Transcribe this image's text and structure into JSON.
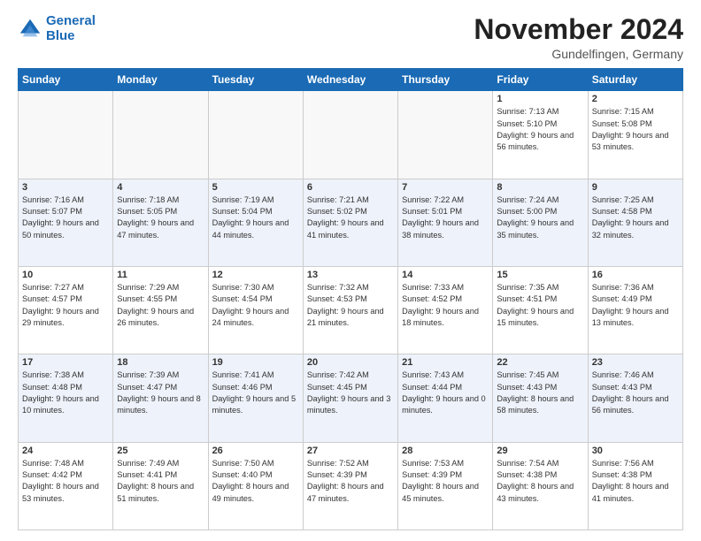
{
  "header": {
    "logo_line1": "General",
    "logo_line2": "Blue",
    "month_title": "November 2024",
    "location": "Gundelfingen, Germany"
  },
  "weekdays": [
    "Sunday",
    "Monday",
    "Tuesday",
    "Wednesday",
    "Thursday",
    "Friday",
    "Saturday"
  ],
  "weeks": [
    [
      {
        "day": "",
        "info": ""
      },
      {
        "day": "",
        "info": ""
      },
      {
        "day": "",
        "info": ""
      },
      {
        "day": "",
        "info": ""
      },
      {
        "day": "",
        "info": ""
      },
      {
        "day": "1",
        "info": "Sunrise: 7:13 AM\nSunset: 5:10 PM\nDaylight: 9 hours and 56 minutes."
      },
      {
        "day": "2",
        "info": "Sunrise: 7:15 AM\nSunset: 5:08 PM\nDaylight: 9 hours and 53 minutes."
      }
    ],
    [
      {
        "day": "3",
        "info": "Sunrise: 7:16 AM\nSunset: 5:07 PM\nDaylight: 9 hours and 50 minutes."
      },
      {
        "day": "4",
        "info": "Sunrise: 7:18 AM\nSunset: 5:05 PM\nDaylight: 9 hours and 47 minutes."
      },
      {
        "day": "5",
        "info": "Sunrise: 7:19 AM\nSunset: 5:04 PM\nDaylight: 9 hours and 44 minutes."
      },
      {
        "day": "6",
        "info": "Sunrise: 7:21 AM\nSunset: 5:02 PM\nDaylight: 9 hours and 41 minutes."
      },
      {
        "day": "7",
        "info": "Sunrise: 7:22 AM\nSunset: 5:01 PM\nDaylight: 9 hours and 38 minutes."
      },
      {
        "day": "8",
        "info": "Sunrise: 7:24 AM\nSunset: 5:00 PM\nDaylight: 9 hours and 35 minutes."
      },
      {
        "day": "9",
        "info": "Sunrise: 7:25 AM\nSunset: 4:58 PM\nDaylight: 9 hours and 32 minutes."
      }
    ],
    [
      {
        "day": "10",
        "info": "Sunrise: 7:27 AM\nSunset: 4:57 PM\nDaylight: 9 hours and 29 minutes."
      },
      {
        "day": "11",
        "info": "Sunrise: 7:29 AM\nSunset: 4:55 PM\nDaylight: 9 hours and 26 minutes."
      },
      {
        "day": "12",
        "info": "Sunrise: 7:30 AM\nSunset: 4:54 PM\nDaylight: 9 hours and 24 minutes."
      },
      {
        "day": "13",
        "info": "Sunrise: 7:32 AM\nSunset: 4:53 PM\nDaylight: 9 hours and 21 minutes."
      },
      {
        "day": "14",
        "info": "Sunrise: 7:33 AM\nSunset: 4:52 PM\nDaylight: 9 hours and 18 minutes."
      },
      {
        "day": "15",
        "info": "Sunrise: 7:35 AM\nSunset: 4:51 PM\nDaylight: 9 hours and 15 minutes."
      },
      {
        "day": "16",
        "info": "Sunrise: 7:36 AM\nSunset: 4:49 PM\nDaylight: 9 hours and 13 minutes."
      }
    ],
    [
      {
        "day": "17",
        "info": "Sunrise: 7:38 AM\nSunset: 4:48 PM\nDaylight: 9 hours and 10 minutes."
      },
      {
        "day": "18",
        "info": "Sunrise: 7:39 AM\nSunset: 4:47 PM\nDaylight: 9 hours and 8 minutes."
      },
      {
        "day": "19",
        "info": "Sunrise: 7:41 AM\nSunset: 4:46 PM\nDaylight: 9 hours and 5 minutes."
      },
      {
        "day": "20",
        "info": "Sunrise: 7:42 AM\nSunset: 4:45 PM\nDaylight: 9 hours and 3 minutes."
      },
      {
        "day": "21",
        "info": "Sunrise: 7:43 AM\nSunset: 4:44 PM\nDaylight: 9 hours and 0 minutes."
      },
      {
        "day": "22",
        "info": "Sunrise: 7:45 AM\nSunset: 4:43 PM\nDaylight: 8 hours and 58 minutes."
      },
      {
        "day": "23",
        "info": "Sunrise: 7:46 AM\nSunset: 4:43 PM\nDaylight: 8 hours and 56 minutes."
      }
    ],
    [
      {
        "day": "24",
        "info": "Sunrise: 7:48 AM\nSunset: 4:42 PM\nDaylight: 8 hours and 53 minutes."
      },
      {
        "day": "25",
        "info": "Sunrise: 7:49 AM\nSunset: 4:41 PM\nDaylight: 8 hours and 51 minutes."
      },
      {
        "day": "26",
        "info": "Sunrise: 7:50 AM\nSunset: 4:40 PM\nDaylight: 8 hours and 49 minutes."
      },
      {
        "day": "27",
        "info": "Sunrise: 7:52 AM\nSunset: 4:39 PM\nDaylight: 8 hours and 47 minutes."
      },
      {
        "day": "28",
        "info": "Sunrise: 7:53 AM\nSunset: 4:39 PM\nDaylight: 8 hours and 45 minutes."
      },
      {
        "day": "29",
        "info": "Sunrise: 7:54 AM\nSunset: 4:38 PM\nDaylight: 8 hours and 43 minutes."
      },
      {
        "day": "30",
        "info": "Sunrise: 7:56 AM\nSunset: 4:38 PM\nDaylight: 8 hours and 41 minutes."
      }
    ]
  ]
}
